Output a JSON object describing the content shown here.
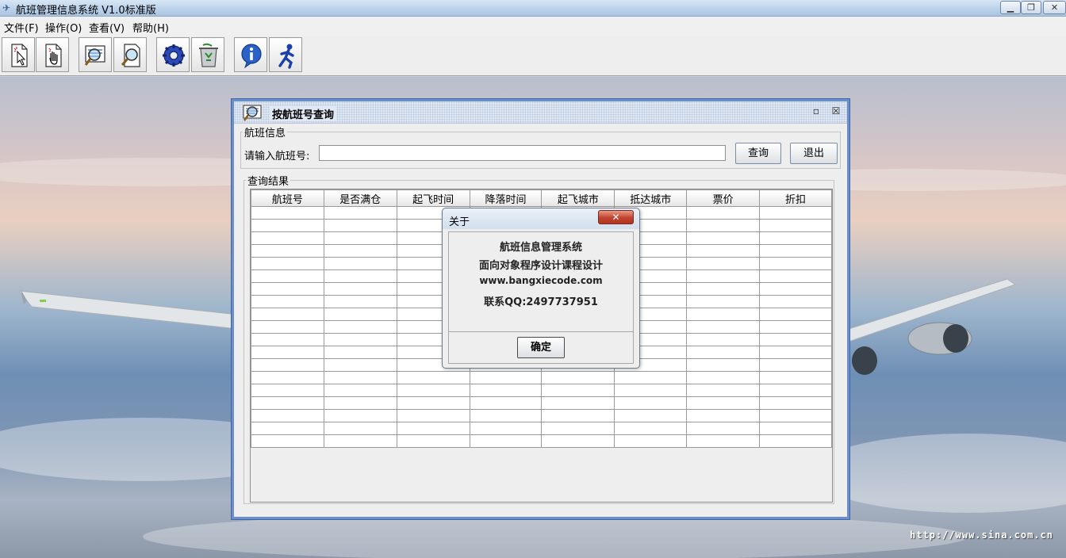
{
  "window": {
    "title": "航班管理信息系统 V1.0标准版",
    "controls": {
      "minimize": "▁",
      "restore": "❐",
      "close": "✕"
    }
  },
  "menu": {
    "items": [
      {
        "label": "文件(F)"
      },
      {
        "label": "操作(O)"
      },
      {
        "label": "查看(V)"
      },
      {
        "label": "帮助(H)"
      }
    ]
  },
  "toolbar": {
    "buttons": [
      {
        "icon": "document-cursor-icon"
      },
      {
        "icon": "document-hand-icon"
      },
      {
        "icon": "search-list-icon"
      },
      {
        "icon": "search-document-icon"
      },
      {
        "icon": "settings-gear-icon"
      },
      {
        "icon": "recycle-bin-icon"
      },
      {
        "icon": "info-icon"
      },
      {
        "icon": "exit-runner-icon"
      }
    ]
  },
  "query_frame": {
    "title": "按航班号查询",
    "controls": {
      "restore": "▫",
      "close": "☒"
    },
    "flight_group": {
      "legend": "航班信息",
      "input_label": "请输入航班号:",
      "input_value": "",
      "query_button": "查询",
      "exit_button": "退出"
    },
    "results_group": {
      "legend": "查询结果",
      "columns": [
        "航班号",
        "是否满仓",
        "起飞时间",
        "降落时间",
        "起飞城市",
        "抵达城市",
        "票价",
        "折扣"
      ],
      "rows": []
    }
  },
  "about_dialog": {
    "title": "关于",
    "close_symbol": "✕",
    "lines": [
      "航班信息管理系统",
      "面向对象程序设计课程设计",
      "www.bangxiecode.com",
      "联系QQ:2497737951"
    ],
    "ok_button": "确定"
  },
  "watermark": "http://www.sina.com.cn",
  "colors": {
    "frame_border": "#6d8fc8",
    "close_button": "#c0432e",
    "panel_bg": "#eeeeee"
  }
}
